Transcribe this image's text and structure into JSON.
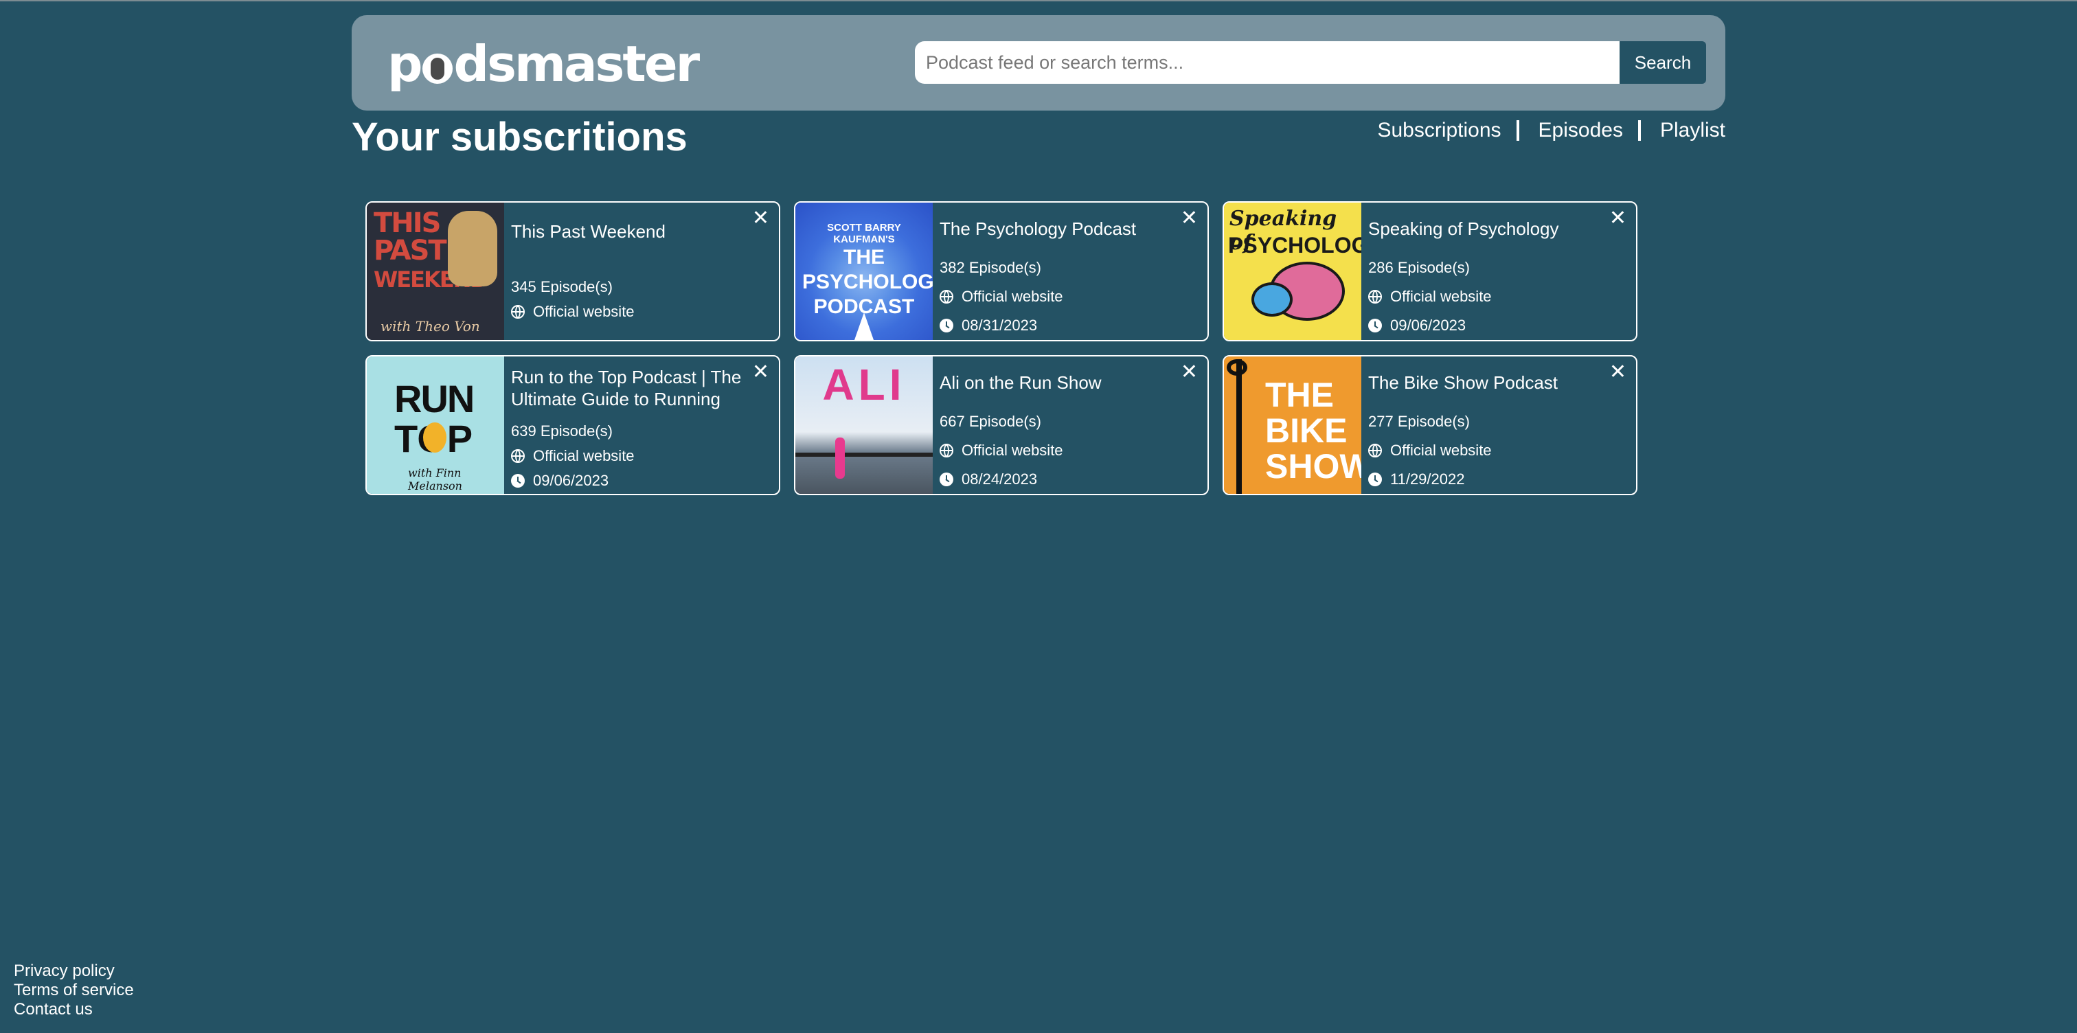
{
  "header": {
    "logo_text_a": "p",
    "logo_text_b": "dsmaster",
    "search": {
      "placeholder": "Podcast feed or search terms...",
      "value": "",
      "button_label": "Search"
    }
  },
  "page": {
    "title": "Your subscritions"
  },
  "nav": {
    "items": [
      {
        "label": "Subscriptions"
      },
      {
        "label": "Episodes"
      },
      {
        "label": "Playlist"
      }
    ]
  },
  "subscriptions": [
    {
      "title": "This Past Weekend",
      "episodes": "345 Episode(s)",
      "website": "Official website",
      "date": "",
      "art": {
        "line1": "THIS",
        "line2": "PAST",
        "line3": "WEEKEND",
        "signature": "with Theo Von"
      }
    },
    {
      "title": "The Psychology Podcast",
      "episodes": "382 Episode(s)",
      "website": "Official website",
      "date": "08/31/2023",
      "art": {
        "line1": "SCOTT BARRY KAUFMAN'S",
        "line2": "THE PSYCHOLOGY PODCAST"
      }
    },
    {
      "title": "Speaking of Psychology",
      "episodes": "286 Episode(s)",
      "website": "Official website",
      "date": "09/06/2023",
      "art": {
        "line1": "Speaking of",
        "line2": "PSYCHOLOGY"
      }
    },
    {
      "title": "Run to the Top Podcast | The Ultimate Guide to Running",
      "episodes": "639 Episode(s)",
      "website": "Official website",
      "date": "09/06/2023",
      "art": {
        "line1": "RUN",
        "line2": "TOP",
        "line3": "with Finn Melanson"
      }
    },
    {
      "title": "Ali on the Run Show",
      "episodes": "667 Episode(s)",
      "website": "Official website",
      "date": "08/24/2023",
      "art": {
        "line1": "ALI"
      }
    },
    {
      "title": "The Bike Show Podcast",
      "episodes": "277 Episode(s)",
      "website": "Official website",
      "date": "11/29/2022",
      "art": {
        "line1": "THE BIKE SHOW"
      }
    }
  ],
  "card_close_glyph": "✕",
  "footer": {
    "links": [
      {
        "label": "Privacy policy"
      },
      {
        "label": "Terms of service"
      },
      {
        "label": "Contact us"
      }
    ]
  },
  "colors": {
    "background": "#245264",
    "header": "#7993a0",
    "button": "#245264"
  }
}
